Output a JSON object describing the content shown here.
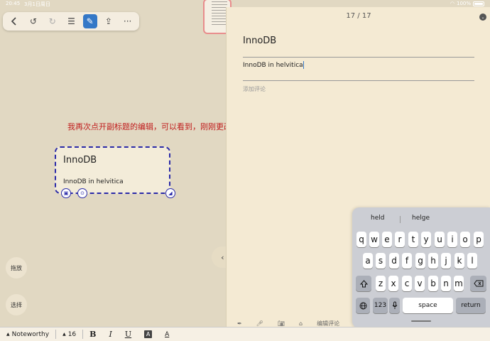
{
  "status": {
    "time": "20:45",
    "date": "3月1日周日",
    "battery": "100%"
  },
  "toolbar": {
    "items": [
      {
        "name": "back-icon",
        "glyph": "‹"
      },
      {
        "name": "undo-icon",
        "glyph": "↺"
      },
      {
        "name": "redo-icon",
        "glyph": "↻"
      },
      {
        "name": "list-icon",
        "glyph": "☰"
      },
      {
        "name": "edit-icon",
        "glyph": "✎"
      },
      {
        "name": "share-icon",
        "glyph": "⇪"
      },
      {
        "name": "more-icon",
        "glyph": "···"
      }
    ]
  },
  "annotation": "我再次点开副标题的编辑，可以看到，刚刚更改的字体还是没有生效",
  "card": {
    "title": "InnoDB",
    "subtitle": "InnoDB in helvitica"
  },
  "side": {
    "drag": "拖放",
    "select": "选择"
  },
  "panel": {
    "page": "17 / 17",
    "title": "InnoDB",
    "subtitle": "InnoDB in helvitica",
    "comment_placeholder": "添加评论",
    "bottom_label": "编辑评论"
  },
  "keyboard": {
    "suggestions": [
      "held",
      "helge"
    ],
    "row1": [
      "q",
      "w",
      "e",
      "r",
      "t",
      "y",
      "u",
      "i",
      "o",
      "p"
    ],
    "row2": [
      "a",
      "s",
      "d",
      "f",
      "g",
      "h",
      "j",
      "k",
      "l"
    ],
    "row3": [
      "z",
      "x",
      "c",
      "v",
      "b",
      "n",
      "m"
    ],
    "numbers": "123",
    "space": "space",
    "return": "return"
  },
  "format": {
    "font": "Noteworthy",
    "size": "16",
    "bold": "B",
    "italic": "I",
    "underline": "U",
    "highlight": "A",
    "color": "A"
  }
}
